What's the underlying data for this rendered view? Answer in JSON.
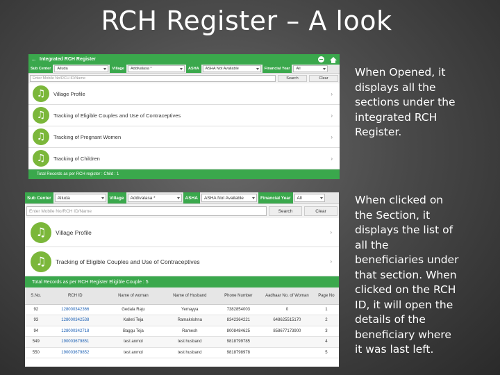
{
  "slide": {
    "title": "RCH Register – A look",
    "caption1": "When Opened, it displays all the sections under the integrated RCH Register.",
    "caption2": "When clicked on the Section, it displays the list of all the beneficiaries under that section. When clicked on the RCH ID, it will open the details of the beneficiary where it was last left."
  },
  "shot1": {
    "header_title": "Integrated RCH Register",
    "filters": {
      "sub_center_label": "Sub Center",
      "sub_center_value": "Alluda",
      "village_label": "Village",
      "village_value": "Addivalasa *",
      "asha_label": "ASHA",
      "asha_value": "ASHA Not Available",
      "fy_label": "Financial Year",
      "fy_value": "All"
    },
    "search_placeholder": "Enter Mobile No/RCH ID/Name",
    "search_btn": "Search",
    "clear_btn": "Clear",
    "sections": [
      {
        "label": "Village Profile"
      },
      {
        "label": "Tracking of Eligible Couples and Use of Contraceptives"
      },
      {
        "label": "Tracking of Pregnant Women"
      },
      {
        "label": "Tracking of Children"
      }
    ],
    "footer": "Total Records as per RCH register : Child : 1"
  },
  "shot2": {
    "filters": {
      "sub_center_label": "Sub Center",
      "sub_center_value": "Alluda",
      "village_label": "Village",
      "village_value": "Addivalasa *",
      "asha_label": "ASHA",
      "asha_value": "ASHA Not Available",
      "fy_label": "Financial Year",
      "fy_value": "All"
    },
    "search_placeholder": "Enter Mobile No/RCH ID/Name",
    "search_btn": "Search",
    "clear_btn": "Clear",
    "sections": [
      {
        "label": "Village Profile"
      },
      {
        "label": "Tracking of Eligible Couples and Use of Contraceptives"
      }
    ],
    "total_bar": "Total Records as per RCH Register   Eligible Couple : 5",
    "table": {
      "headers": [
        "S.No.",
        "RCH ID",
        "Name of woman",
        "Name of Husband",
        "Phone Number",
        "Aadhaar No. of Woman",
        "Page No"
      ],
      "rows": [
        [
          "92",
          "128000342366",
          "Gedala Raju",
          "Yemayya",
          "7382854003",
          "0",
          "1"
        ],
        [
          "93",
          "128000342538",
          "Kalleti Teja",
          "Ramakrishna",
          "8342364221",
          "648625515170",
          "2"
        ],
        [
          "94",
          "128000342718",
          "Baggu Teja",
          "Ramesh",
          "8008484625",
          "858677173900",
          "3"
        ],
        [
          "549",
          "190003679851",
          "test anmol",
          "test husband",
          "9818799785",
          "",
          "4"
        ],
        [
          "550",
          "190003679852",
          "test anmol",
          "test husband",
          "9818798978",
          "",
          "5"
        ]
      ]
    }
  }
}
